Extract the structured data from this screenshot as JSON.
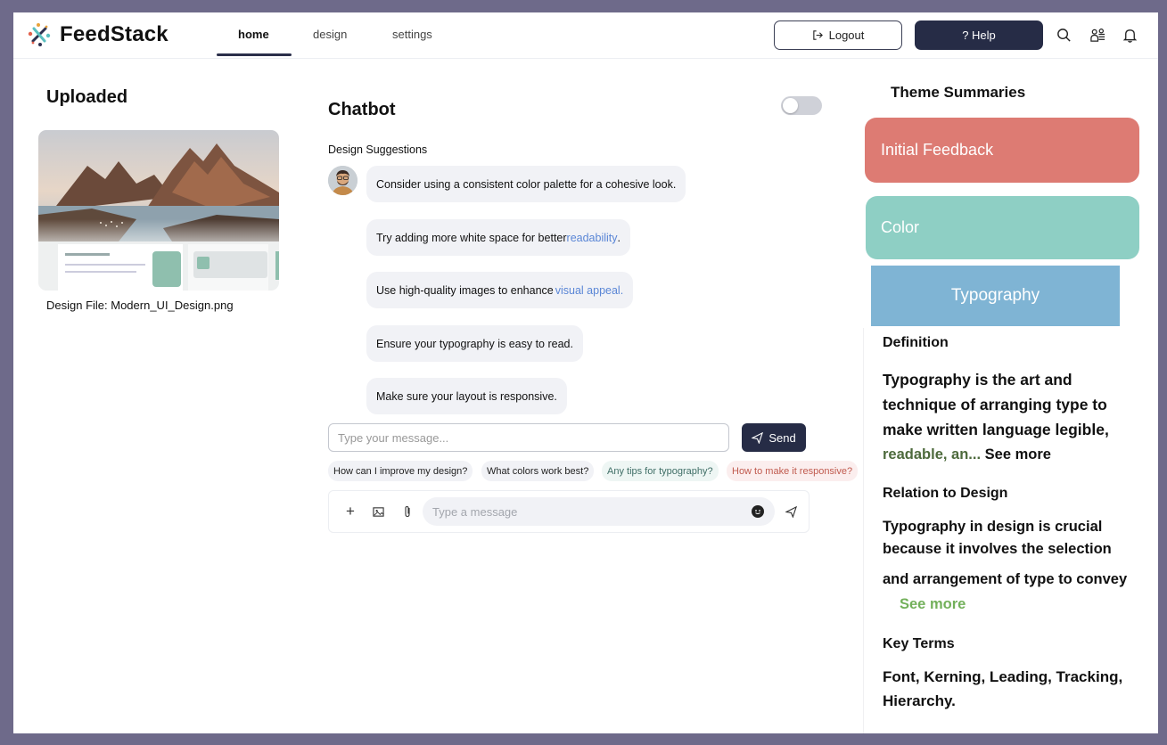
{
  "app": {
    "name": "FeedStack"
  },
  "nav": {
    "tabs": [
      {
        "label": "home",
        "active": true
      },
      {
        "label": "design",
        "active": false
      },
      {
        "label": "settings",
        "active": false
      }
    ],
    "logout_label": "Logout",
    "help_label": "? Help",
    "icons": [
      "search-icon",
      "users-icon",
      "bell-icon"
    ]
  },
  "uploaded": {
    "title": "Uploaded",
    "file_label": "Design File: Modern_UI_Design.png"
  },
  "chatbot": {
    "title": "Chatbot",
    "toggle_on": false,
    "suggestions_label": "Design Suggestions",
    "messages": [
      {
        "text": "Consider using a consistent color palette for a cohesive look.",
        "highlight": ""
      },
      {
        "text": "Try adding more white space for better",
        "highlight": "readability",
        "tail": "."
      },
      {
        "text": "Use high-quality images to enhance",
        "highlight": "visual appeal.",
        "tail": ""
      },
      {
        "text": "Ensure your typography is easy to read.",
        "highlight": ""
      },
      {
        "text": "Make sure your layout is responsive.",
        "highlight": ""
      }
    ],
    "input_placeholder": "Type your message...",
    "send_label": "Send",
    "quick_replies": [
      {
        "label": "How can I improve my design?",
        "bg": "#f1f2f6",
        "color": "#222"
      },
      {
        "label": "What colors work best?",
        "bg": "#f1f2f6",
        "color": "#222"
      },
      {
        "label": "Any tips for typography?",
        "bg": "#eef6f4",
        "color": "#3f6e66"
      },
      {
        "label": "How to make it responsive?",
        "bg": "#fbeeee",
        "color": "#c05a4e"
      }
    ],
    "composer_placeholder": "Type a message"
  },
  "themes": {
    "title": "Theme Summaries",
    "cards": [
      {
        "label": "Initial Feedback",
        "color": "#dd7b73"
      },
      {
        "label": "Color",
        "color": "#8ecfc4"
      },
      {
        "label": "Typography",
        "color": "#7fb4d4"
      }
    ]
  },
  "typography_panel": {
    "definition_heading": "Definition",
    "definition_line1": "Typography is the art and",
    "definition_line2": "technique of arranging type to",
    "definition_line3": "make written language legible,",
    "definition_line4": "readable, an...",
    "see_more_1": "See more",
    "relation_heading": "Relation to Design",
    "relation_line1": "Typography in design is crucial",
    "relation_line2": "because it involves the selection",
    "relation_line3": "and arrangement of type to convey",
    "see_more_2": "See more",
    "key_terms_heading": "Key Terms",
    "key_terms_line1": "Font, Kerning, Leading, Tracking,",
    "key_terms_line2": "Hierarchy."
  }
}
